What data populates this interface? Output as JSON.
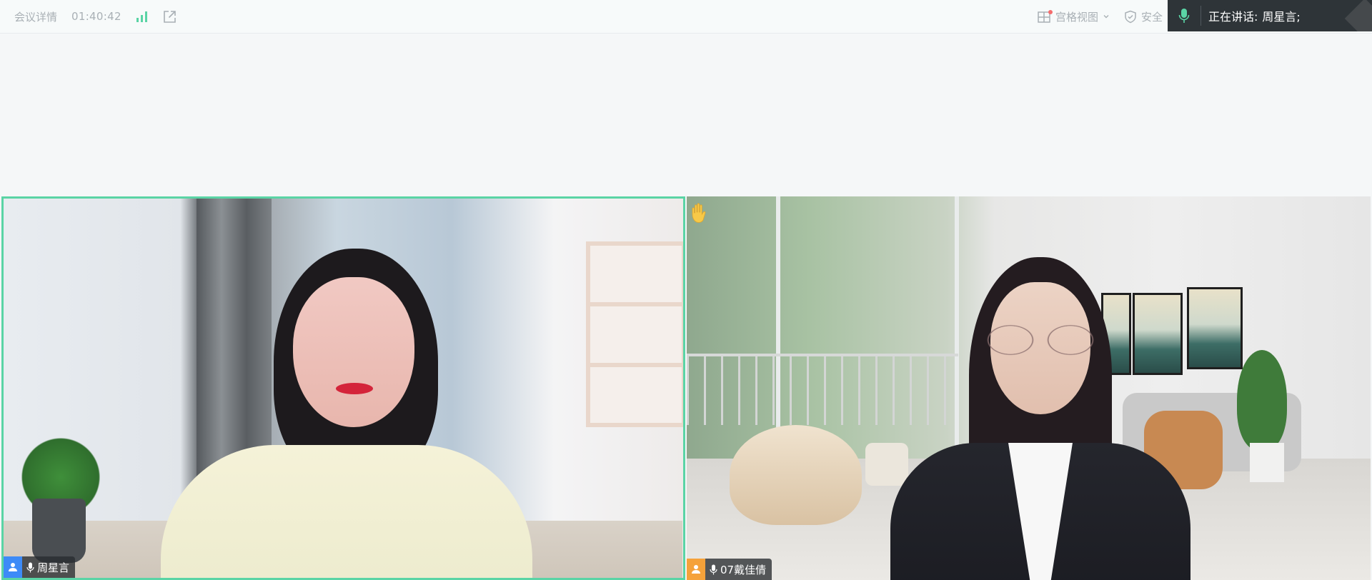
{
  "topbar": {
    "meeting_details": "会议详情",
    "timer": "01:40:42",
    "grid_view": "宫格视图",
    "security": "安全"
  },
  "speaking": {
    "label": "正在讲话:",
    "names": "周星言;"
  },
  "participants": [
    {
      "name": "周星言",
      "avatar_color": "#3d8bf7",
      "active_speaker": true
    },
    {
      "name": "07戴佳倩",
      "avatar_color": "#f5a23a",
      "hand_raised": true
    }
  ],
  "colors": {
    "active_border": "#5ad4a5",
    "signal": "#5ad4a5",
    "notification_dot": "#f56c6c"
  },
  "icons": [
    "signal-icon",
    "share-out-icon",
    "grid-icon",
    "chevron-down-icon",
    "shield-icon",
    "microphone-icon",
    "user-avatar-icon",
    "raised-hand-icon"
  ]
}
